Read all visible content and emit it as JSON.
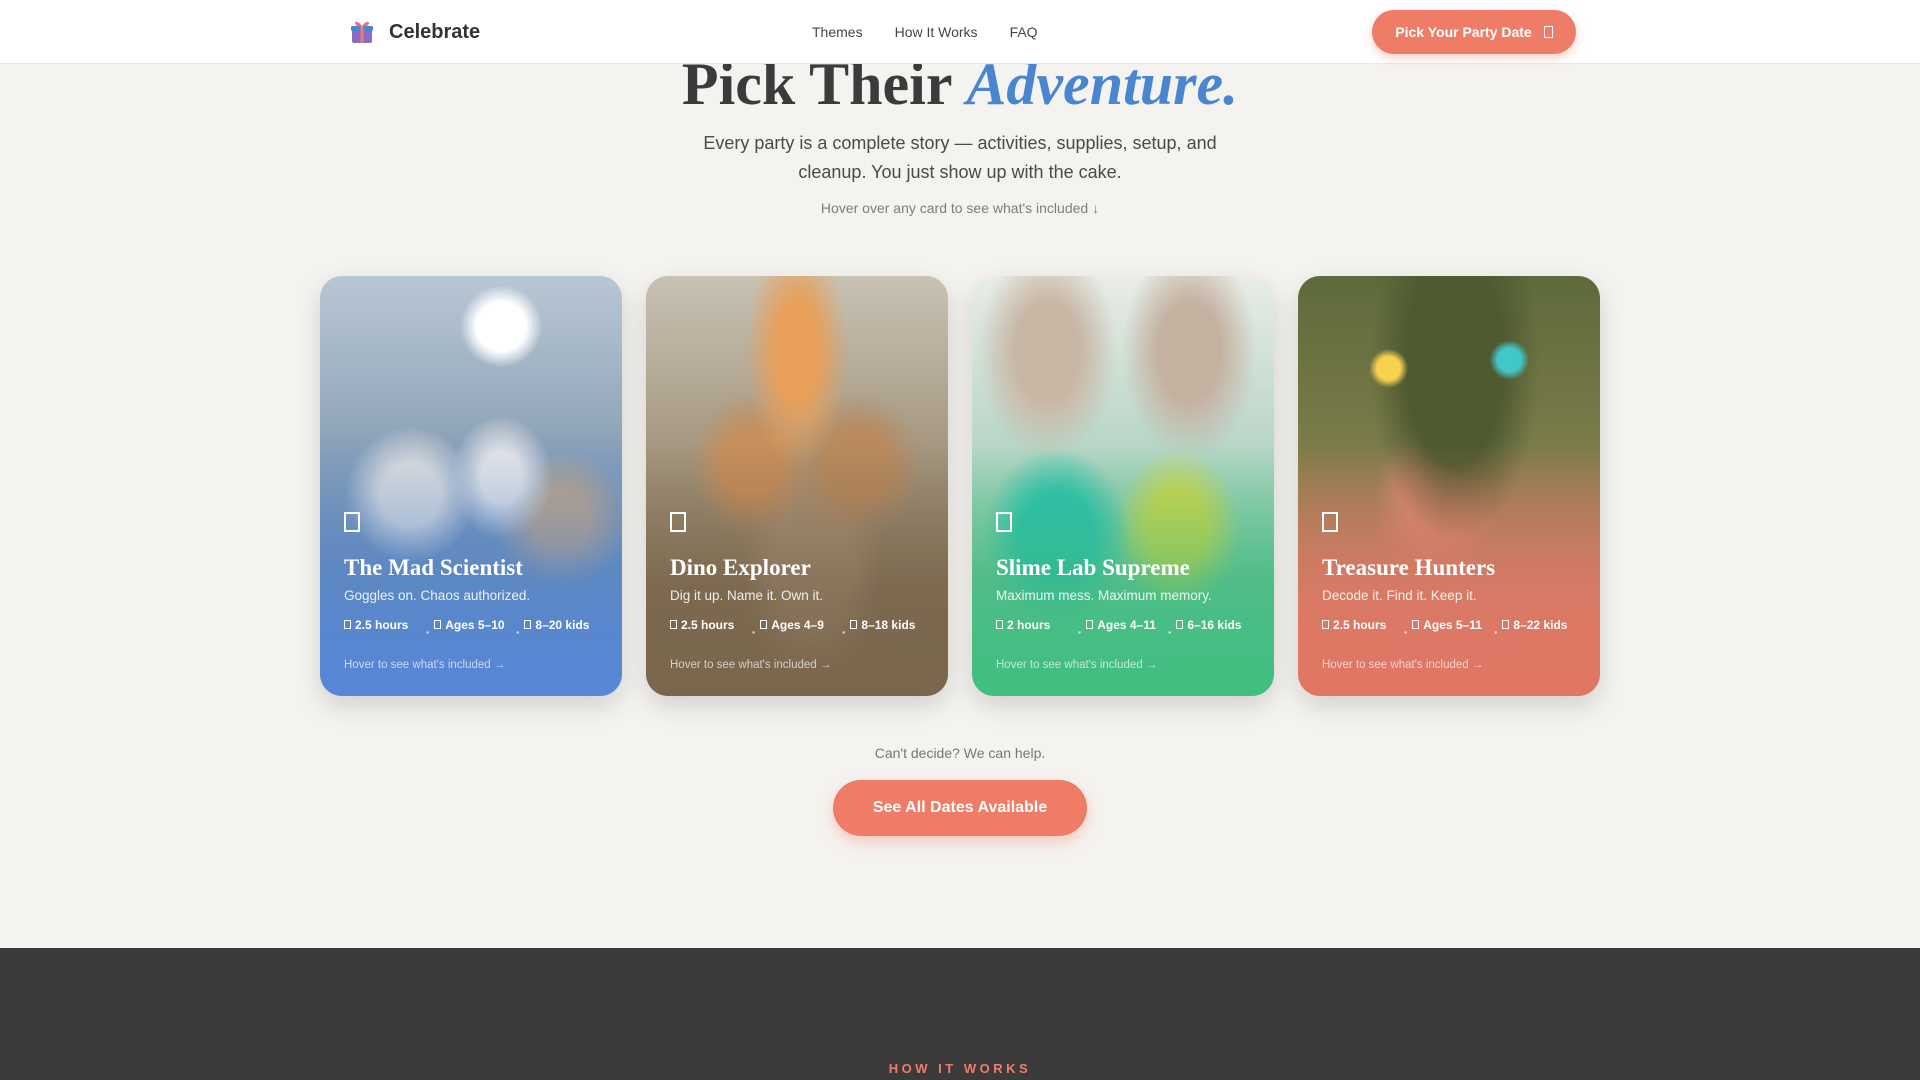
{
  "header": {
    "brand": "Celebrate",
    "nav": [
      "Themes",
      "How It Works",
      "FAQ"
    ],
    "cta": "Pick Your Party Date",
    "cta_icon": "calendar-icon"
  },
  "hero": {
    "title_main": "Pick Their ",
    "title_accent": "Adventure.",
    "subtitle": "Every party is a complete story — activities, supplies, setup, and cleanup. You just show up with the cake.",
    "hint": "Hover over any card to see what's included ↓"
  },
  "cards": [
    {
      "title": "The Mad Scientist",
      "tagline": "Goggles on. Chaos authorized.",
      "duration": "2.5 hours",
      "ages": "Ages 5–10",
      "kids": "8–20 kids",
      "hover": "Hover to see what's included →",
      "color": "#5a89d6"
    },
    {
      "title": "Dino Explorer",
      "tagline": "Dig it up. Name it. Own it.",
      "duration": "2.5 hours",
      "ages": "Ages 4–9",
      "kids": "8–18 kids",
      "hover": "Hover to see what's included →",
      "color": "#7d6b52"
    },
    {
      "title": "Slime Lab Supreme",
      "tagline": "Maximum mess. Maximum memory.",
      "duration": "2 hours",
      "ages": "Ages 4–11",
      "kids": "6–16 kids",
      "hover": "Hover to see what's included →",
      "color": "#46c584"
    },
    {
      "title": "Treasure Hunters",
      "tagline": "Decode it. Find it. Keep it.",
      "duration": "2.5 hours",
      "ages": "Ages 5–11",
      "kids": "8–22 kids",
      "hover": "Hover to see what's included →",
      "color": "#e2796a"
    }
  ],
  "help": {
    "text": "Can't decide? We can help.",
    "cta": "See All Dates Available"
  },
  "section": {
    "eyebrow": "HOW IT WORKS"
  },
  "colors": {
    "accent": "#ef7c66",
    "blue": "#4a86cf",
    "background": "#f5f3ef",
    "dark": "#3b3b3b"
  }
}
